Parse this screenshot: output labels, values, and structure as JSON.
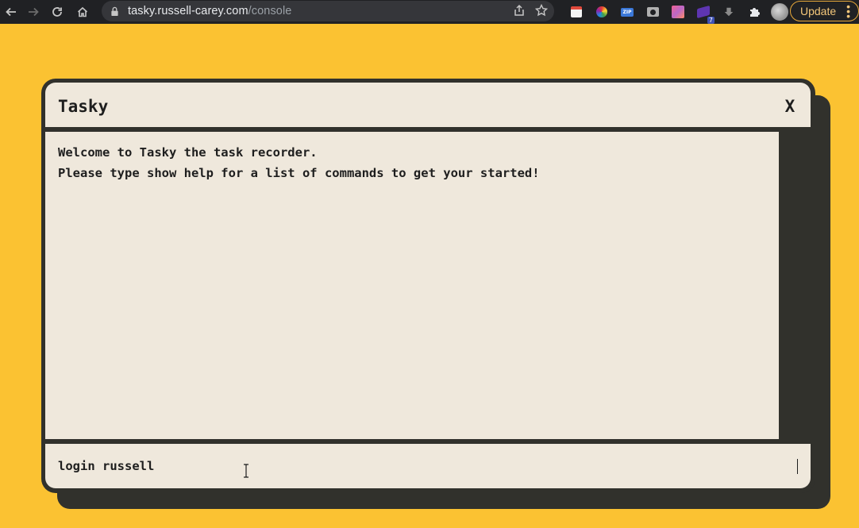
{
  "browser": {
    "url_host": "tasky.russell-carey.com",
    "url_path": "/console",
    "update_label": "Update",
    "extension_badge": "7",
    "extensions": [
      "calendar-ext-icon",
      "color-wheel-ext-icon",
      "zip-ext-icon",
      "camera-ext-icon",
      "gradient-ext-icon",
      "puzzle-ext-icon",
      "avatar"
    ]
  },
  "console": {
    "title": "Tasky",
    "close_label": "X",
    "output_lines": [
      "Welcome to Tasky the task recorder.",
      "Please type show help for a list of commands to get your started!"
    ],
    "input_value": "login russell"
  },
  "colors": {
    "page_bg": "#fbc232",
    "panel_bg": "#efe8dc",
    "frame": "#31312c",
    "text": "#1e1e1e"
  }
}
